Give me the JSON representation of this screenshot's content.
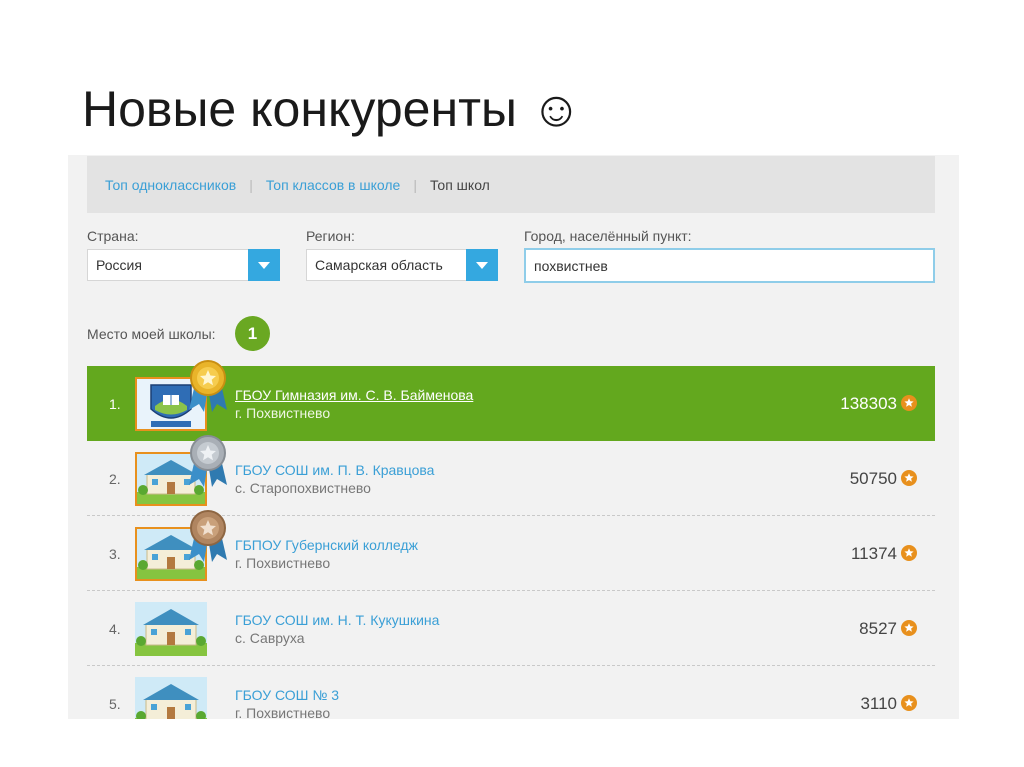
{
  "slide": {
    "title": "Новые конкуренты ☺"
  },
  "tabs": [
    {
      "label": "Топ одноклассников",
      "active": false
    },
    {
      "label": "Топ классов в школе",
      "active": false
    },
    {
      "label": "Топ школ",
      "active": true
    }
  ],
  "filters": {
    "country": {
      "label": "Страна:",
      "value": "Россия"
    },
    "region": {
      "label": "Регион:",
      "value": "Самарская область"
    },
    "city": {
      "label": "Город, населённый пункт:",
      "value": "похвистнев"
    }
  },
  "my_place": {
    "label": "Место моей школы:",
    "value": "1"
  },
  "schools": [
    {
      "rank": "1.",
      "name": "ГБОУ Гимназия им. С. В. Байменова",
      "city": "г. Похвистнево",
      "score": "138303",
      "medal": "gold",
      "highlighted": true
    },
    {
      "rank": "2.",
      "name": "ГБОУ СОШ им. П. В. Кравцова",
      "city": "с. Старопохвистнево",
      "score": "50750",
      "medal": "silver",
      "highlighted": false
    },
    {
      "rank": "3.",
      "name": "ГБПОУ Губернский колледж",
      "city": "г. Похвистнево",
      "score": "11374",
      "medal": "bronze",
      "highlighted": false
    },
    {
      "rank": "4.",
      "name": "ГБОУ СОШ им. Н. Т. Кукушкина",
      "city": "с. Савруха",
      "score": "8527",
      "medal": "none",
      "highlighted": false
    },
    {
      "rank": "5.",
      "name": "ГБОУ СОШ № 3",
      "city": "г. Похвистнево",
      "score": "3110",
      "medal": "none",
      "highlighted": false
    }
  ],
  "colors": {
    "accent_green": "#63a81e",
    "link_blue": "#3a9fd6",
    "dropdown_blue": "#34a8e0",
    "star_orange": "#e8901d",
    "medal_gold": "#e9b42a",
    "medal_silver": "#a9afb6",
    "medal_bronze": "#b08560"
  },
  "icons": {
    "dropdown": "chevron-down-icon",
    "star": "star-icon",
    "medal": "medal-icon",
    "school_thumb": "school-building-icon",
    "gymnasium_logo": "school-emblem-icon"
  }
}
